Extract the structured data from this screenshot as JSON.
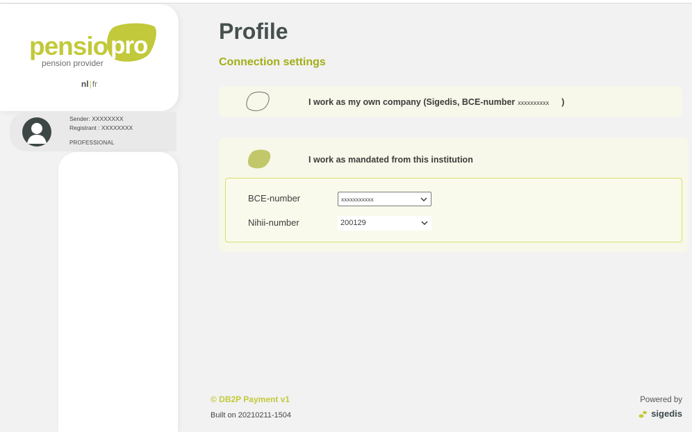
{
  "brand": {
    "logo_word": "pension",
    "logo_badge": "pro",
    "logo_sub": "pension provider",
    "lang_active": "nl",
    "lang_separator": "|",
    "lang_other": "fr",
    "accent": "#c2c93a"
  },
  "user": {
    "sender": "Sender:  XXXXXXXX",
    "registrant": "Registrant :  XXXXXXXX",
    "role": "PROFESSIONAL"
  },
  "page": {
    "title": "Profile",
    "section": "Connection settings"
  },
  "options": {
    "own": {
      "label": "I work as my own company (Sigedis, BCE-number",
      "bce": "xxxxxxxxxx",
      "close": ")"
    },
    "mandated": {
      "label": "I work as mandated from this institution",
      "bce_label": "BCE-number",
      "bce_value": "xxxxxxxxxxx",
      "nihii_label": "Nihii-number",
      "nihii_value": "200129"
    }
  },
  "footer": {
    "app": "© DB2P Payment   v1",
    "build": "Built on 20210211-1504",
    "powered": "Powered by",
    "vendor": "sigedis"
  }
}
